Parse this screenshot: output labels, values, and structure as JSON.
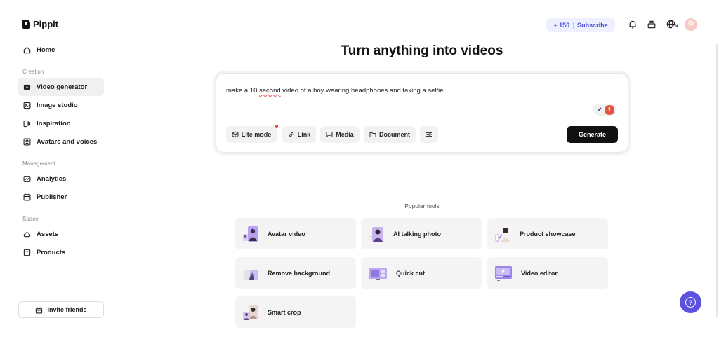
{
  "app": {
    "name": "Pippit"
  },
  "sidebar": {
    "home": {
      "label": "Home",
      "icon": "home-icon"
    },
    "sections": [
      {
        "label": "Creation",
        "items": [
          {
            "label": "Video generator",
            "icon": "video-icon",
            "active": true
          },
          {
            "label": "Image studio",
            "icon": "image-icon"
          },
          {
            "label": "Inspiration",
            "icon": "inspiration-icon"
          },
          {
            "label": "Avatars and voices",
            "icon": "avatar-icon"
          }
        ]
      },
      {
        "label": "Management",
        "items": [
          {
            "label": "Analytics",
            "icon": "analytics-icon"
          },
          {
            "label": "Publisher",
            "icon": "calendar-icon"
          }
        ]
      },
      {
        "label": "Space",
        "items": [
          {
            "label": "Assets",
            "icon": "cloud-icon"
          },
          {
            "label": "Products",
            "icon": "bag-icon"
          }
        ]
      }
    ],
    "invite": {
      "label": "Invite friends",
      "icon": "gift-icon"
    }
  },
  "header": {
    "credits": "+ 150",
    "subscribe": "Subscribe",
    "icons": [
      "bell-icon",
      "stack-icon",
      "language-icon"
    ],
    "language_code": "EN"
  },
  "main": {
    "headline": "Turn anything into videos",
    "prompt": {
      "before": "make a 10 ",
      "misspelled": "second",
      "after": " video of a boy wearing headphones and taking a selfie"
    },
    "badge_count": "1",
    "chips": [
      {
        "label": "Lite mode",
        "icon": "cube-icon"
      },
      {
        "label": "Link",
        "icon": "link-icon"
      },
      {
        "label": "Media",
        "icon": "image-icon"
      },
      {
        "label": "Document",
        "icon": "folder-icon"
      },
      {
        "label": "",
        "icon": "sliders-icon"
      }
    ],
    "generate": "Generate",
    "popular_label": "Popular tools",
    "tools": [
      {
        "label": "Avatar video"
      },
      {
        "label": "AI talking photo"
      },
      {
        "label": "Product showcase"
      },
      {
        "label": "Remove background"
      },
      {
        "label": "Quick cut"
      },
      {
        "label": "Video editor"
      },
      {
        "label": "Smart crop"
      }
    ]
  },
  "help": {
    "label": "?"
  },
  "colors": {
    "accent": "#5b53e0",
    "credits_text": "#4b4fd6",
    "badge": "#e2553e"
  }
}
